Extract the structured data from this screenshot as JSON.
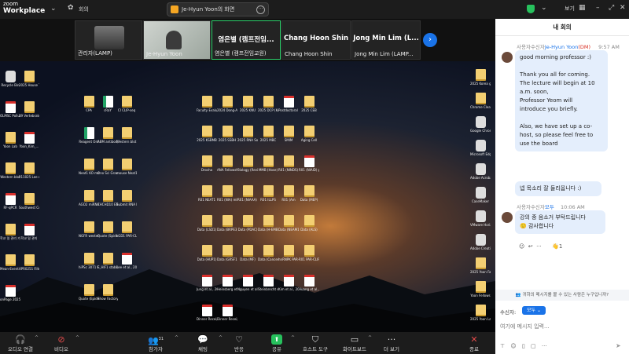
{
  "app": {
    "logo_line1": "zoom",
    "logo_line2": "Workplace"
  },
  "topbar": {
    "meeting_label": "회의",
    "share_label": "Je-Hyun Yoon의 화면"
  },
  "participants": [
    {
      "name": "관리자(LAMP)",
      "big": ""
    },
    {
      "name": "Je-Hyun Yoon",
      "big": ""
    },
    {
      "name": "염은별 (캠프전임교원)",
      "big": "염은별 (캠프전임..."
    },
    {
      "name": "Chang Hoon Shin",
      "big": "Chang Hoon Shin"
    },
    {
      "name": "Jong Min Lim (LAMP...",
      "big": "Jong Min Lim (L..."
    }
  ],
  "desktop": {
    "left_icons": [
      "Recycle Bin",
      "2025 House Tax",
      "OLMSC Pollution",
      "19 Vertebrate Animal_editi",
      "Yoon Lab",
      "Yoon_Kim_...",
      "Western blot",
      "211025 Lee et al., 2025 ML",
      "RF-qPCR",
      "Southwest Code, 45 bill",
      "학교 일 관리 가부",
      "학교 일 관리",
      "Mean-Event 100",
      "APR0251 Filters",
      "onPage 2025"
    ],
    "grid_icons": [
      "CPA",
      "cRaY",
      "CI CLIP-seq",
      "Reagent Ord",
      "ABM antibody",
      "Western blot images",
      "Neat1 KO mouse tail",
      "Ono Sci Grant Approval F...",
      "mouse Neat1 mRNA (19...",
      "AGO2 miRNA-seq",
      "CHCHD10 EBV Stable ...",
      "Submit RNA Biology",
      "NGFR western blot",
      "Quote (Spider IDA)",
      "LGD1 PAR-CLIP",
      "hiPSc 3071 FE_NEAT",
      "E_HIF1 stability (oc...",
      "Lee et al., 2025",
      "Quote (Epidemics)",
      "Show Factory Car Wash",
      "Faculty Evaluati...",
      "2024 Dong-A",
      "2025 KNU",
      "2025 DCP (Korea)",
      "Postdoctoral Scholar Ser...",
      "2025 CEB",
      "2025 KSBMB",
      "2025 SSBH",
      "2025 RNA Society",
      "2025 MBC",
      "SMIM",
      "Aging Cell",
      "Drosha",
      "ANA Fellowship",
      "Biology (Review)",
      "MMB (Hose)",
      "R01 (NINDS) Hippo",
      "R01 (NIAID) packet",
      "R01 NEAT1",
      "R01 (NIA) mito",
      "R01 (NIAAA) Packet",
      "R01 ILLPS",
      "R01 (Am",
      "Data (MEP)",
      "Data (LSD1)",
      "Data (BRPE3)",
      "Data (PDAC)",
      "Data (H-EMB)",
      "Data (NEAM1)",
      "Data (ALS)",
      "Data (HUP1)",
      "Data (GRSF1)",
      "Data (MF)",
      "Data (Cancer Exosome)",
      "hnRNPK PAR-CLIP",
      "R01 PAR-CLIP",
      "Jung et al., 2024 FM C...",
      "Heinsberg et al., 2024 Sc...",
      "Nguyen et al., 2024 Bi...",
      "Steinbrecht et al., 2024 PP...",
      "Kim et al., 2024 FVS",
      "Huang et al., 2024 mobili...",
      "Dinner Receipt (I...",
      "Dinner Receipt (I..."
    ],
    "right_icons": [
      "2025 Korea gallery-...",
      "Chrome Cleaner",
      "Google Chrome",
      "Microsoft Edge",
      "Adobe Acrobat",
      "CaseMaker",
      "VMware Horiz...",
      "Adobe Creati...",
      "2025 Yoon Family (Yo...",
      "Yoon Fellows",
      "2025 Yoon Lab (Ha..."
    ]
  },
  "toolbar": {
    "audio": "오디오 연결",
    "video": "비디오",
    "participants": "참가자",
    "participants_count": "31",
    "chat": "채팅",
    "react": "반응",
    "share": "공유",
    "host_tools": "호스트 도구",
    "whiteboard": "화이트보드",
    "more": "더 보기",
    "end": "종료"
  },
  "chat": {
    "view_label": "보기",
    "title": "내 회의",
    "messages": [
      {
        "meta_prefix": "사용자수신자",
        "meta_to": "Je-Hyun Yoon",
        "meta_dm": "(DM)",
        "time": "9:57 AM",
        "lines": [
          "good morning professor :)",
          "",
          "Thank you all for coming.",
          "The lecture will begin at 10",
          "a.m. soon,",
          "Professor Yeom will",
          "introduce you briefly.",
          "",
          "Also, we have set up a co-",
          "host, so please feel free to",
          "use the board"
        ]
      },
      {
        "text": "넵 목소리 잘 들리웁니다 :)"
      },
      {
        "meta_prefix": "사용자수신자",
        "meta_to": "모두",
        "time": "10:06 AM",
        "lines": [
          "강의 중 음소거 부탁드립니다",
          "🙂 감사합니다"
        ]
      }
    ],
    "reactions_count": "1",
    "notice": "귀하의 메시지를 볼 수 있는 사람은 누구입니까?",
    "recipient_label": "수신자:",
    "recipient_value": "모두",
    "input_placeholder": "여기에 메시지 입력..."
  },
  "colors": {
    "accent": "#1a73e8",
    "share_green": "#27c15d",
    "bubble": "#e4eefc",
    "dm": "#d93025"
  }
}
